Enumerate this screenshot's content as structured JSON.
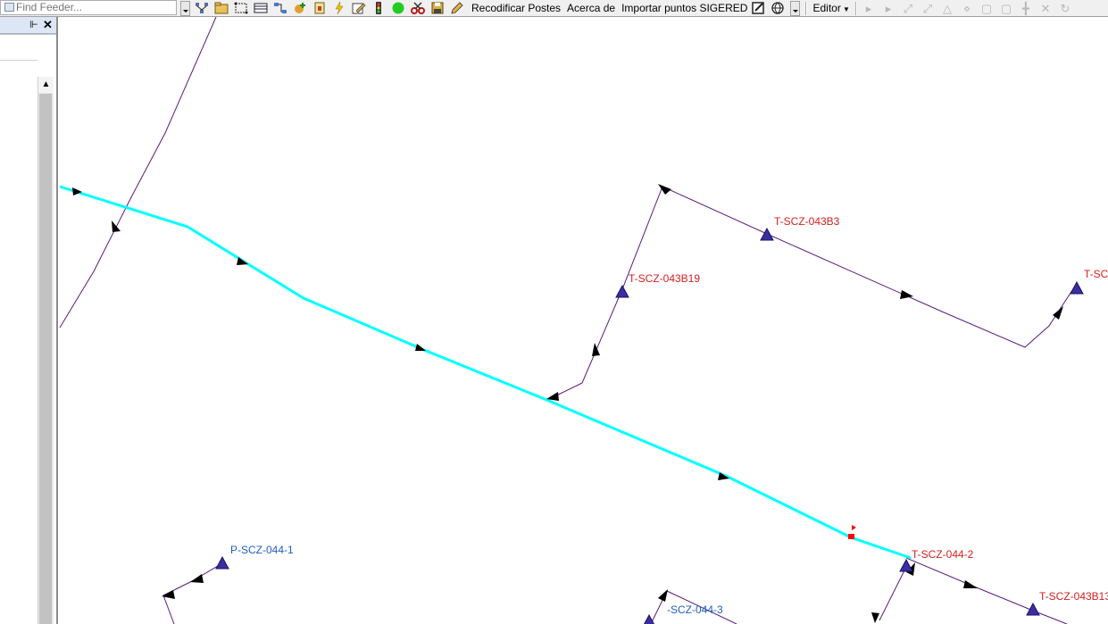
{
  "toolbar": {
    "find_feeder_placeholder": "Find Feeder...",
    "recodificar_label": "Recodificar Postes",
    "acerca_label": "Acerca de",
    "importar_label": "Importar puntos SIGERED",
    "editor_label": "Editor",
    "icons": [
      "trace-network-icon",
      "folder-icon",
      "select-features-icon",
      "table-icon",
      "flow-icon",
      "add-feature-icon",
      "report-icon",
      "lightning-icon",
      "edit-icon",
      "traffic-light-icon",
      "green-dot-icon",
      "scissors-icon",
      "save-icon",
      "pencil-icon"
    ]
  },
  "side_panel": {
    "pin_glyph": "←",
    "close_glyph": "✕",
    "scroll_up_glyph": "▲"
  },
  "map": {
    "labels": {
      "t043b3": "T-SCZ-043B3",
      "t043b19": "T-SCZ-043B19",
      "tsc": "T-SC",
      "p044_1": "P-SCZ-044-1",
      "t044_2": "T-SCZ-044-2",
      "t043b13": "T-SCZ-043B13",
      "s044_3": "-SCZ-044-3"
    },
    "colors": {
      "main_feeder": "#00ffff",
      "branch_line": "#5a1a7a",
      "transformer_fill": "#3a2ea0",
      "label_red": "#d42020",
      "label_blue": "#1f5fbf"
    }
  }
}
